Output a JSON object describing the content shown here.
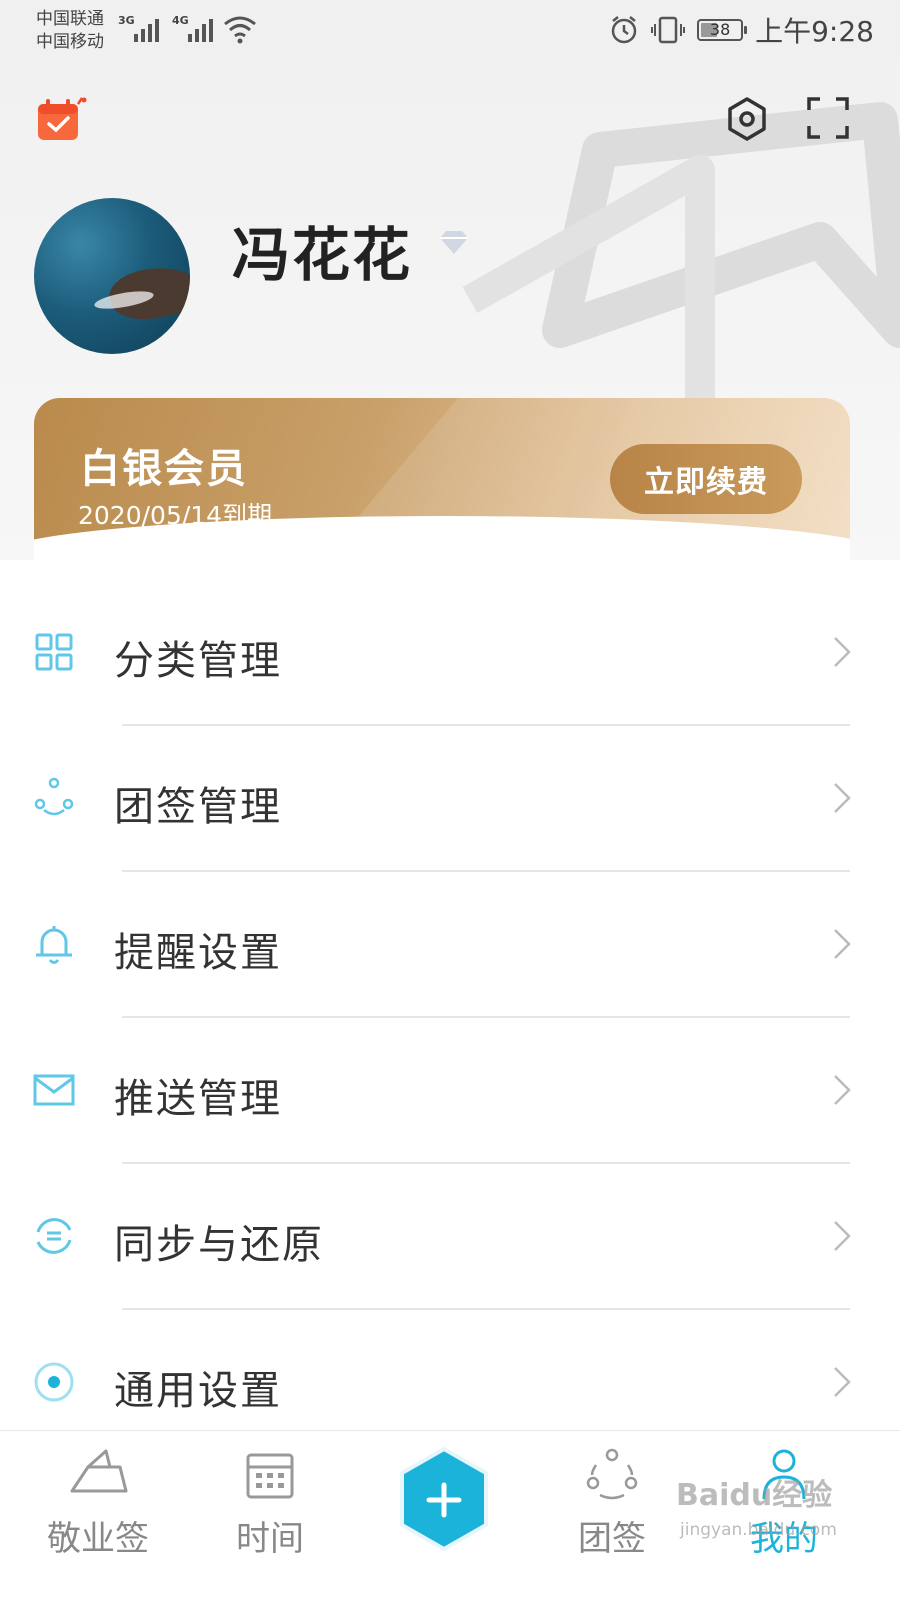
{
  "status_bar": {
    "carrier_1": "中国联通",
    "carrier_2": "中国移动",
    "net_1": "3G",
    "net_2": "4G",
    "battery": "38",
    "time": "上午9:28"
  },
  "header": {
    "calendar_icon": "calendar-check-icon",
    "settings_icon": "hexagon-gear-icon",
    "scan_icon": "scan-frame-icon"
  },
  "profile": {
    "username": "冯花花",
    "badge_icon": "diamond-icon"
  },
  "membership": {
    "title": "白银会员",
    "expiry": "2020/05/14到期",
    "renew_label": "立即续费"
  },
  "menu": {
    "items": [
      {
        "label": "分类管理",
        "icon": "grid-icon"
      },
      {
        "label": "团签管理",
        "icon": "group-circle-icon"
      },
      {
        "label": "提醒设置",
        "icon": "bell-icon"
      },
      {
        "label": "推送管理",
        "icon": "mail-icon"
      },
      {
        "label": "同步与还原",
        "icon": "sync-icon"
      },
      {
        "label": "通用设置",
        "icon": "settings-dot-icon"
      }
    ]
  },
  "tabbar": {
    "tabs": [
      {
        "label": "敬业签",
        "icon": "note-icon"
      },
      {
        "label": "时间",
        "icon": "calendar-icon"
      },
      {
        "label": "团签",
        "icon": "team-icon"
      },
      {
        "label": "我的",
        "icon": "user-icon"
      }
    ],
    "active_index": 3,
    "add_icon": "plus-icon"
  },
  "colors": {
    "accent": "#1bb3d9",
    "gold": "#c79a5e",
    "text": "#333333"
  },
  "watermark": {
    "text": "Baidu经验",
    "sub": "jingyan.baidu.com"
  }
}
